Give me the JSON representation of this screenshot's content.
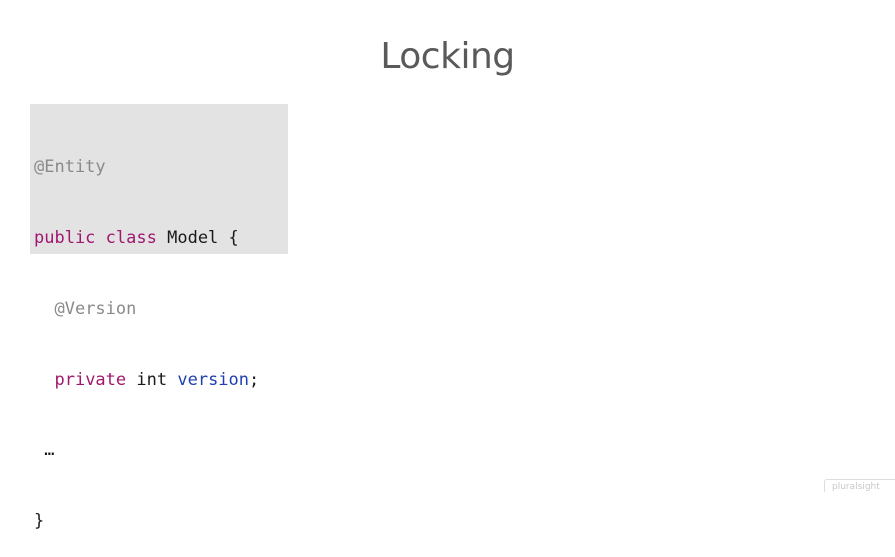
{
  "slide": {
    "title": "Locking"
  },
  "code": {
    "line1": {
      "annotation": "@Entity"
    },
    "line2": {
      "kw1": "public",
      "kw2": "class",
      "name": "Model",
      "brace": "{"
    },
    "line3": {
      "annotation": "@Version"
    },
    "line4": {
      "kw": "private",
      "type": "int",
      "field": "version",
      "semicolon": ";"
    },
    "line5": {
      "ellipsis": "…"
    },
    "line6": {
      "brace": "}"
    }
  },
  "watermark": {
    "brand": "pluralsight"
  },
  "colors": {
    "annotation": "#8a8a8a",
    "keyword": "#a0186e",
    "field": "#1f3fb0",
    "code_background": "#e3e3e4",
    "title": "#5a5a5a"
  }
}
